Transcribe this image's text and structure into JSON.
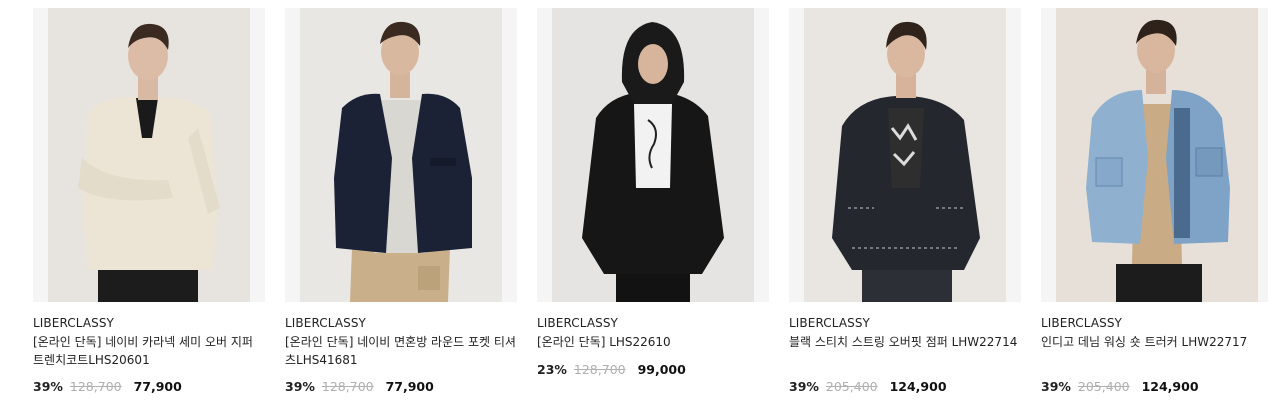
{
  "products": [
    {
      "brand": "LIBERCLASSY",
      "name": "[온라인 단독] 네이비 카라넥 세미 오버 지퍼 트렌치코트LHS20601",
      "discount": "39%",
      "original_price": "128,700",
      "sale_price": "77,900",
      "photo": "model-cream-collarless-jacket"
    },
    {
      "brand": "LIBERCLASSY",
      "name": "[온라인 단독] 네이비 면혼방 라운드 포켓 티셔츠LHS41681",
      "discount": "39%",
      "original_price": "128,700",
      "sale_price": "77,900",
      "photo": "model-navy-jacket"
    },
    {
      "brand": "LIBERCLASSY",
      "name": "[온라인 단독] LHS22610",
      "discount": "23%",
      "original_price": "128,700",
      "sale_price": "99,000",
      "photo": "model-black-hooded-jacket"
    },
    {
      "brand": "LIBERCLASSY",
      "name": "블랙 스티치 스트링 오버핏 점퍼 LHW22714",
      "discount": "39%",
      "original_price": "205,400",
      "sale_price": "124,900",
      "photo": "model-black-stitch-jumper"
    },
    {
      "brand": "LIBERCLASSY",
      "name": "인디고 데님 워싱 숏 트러커 LHW22717",
      "discount": "39%",
      "original_price": "205,400",
      "sale_price": "124,900",
      "photo": "model-denim-trucker"
    }
  ]
}
